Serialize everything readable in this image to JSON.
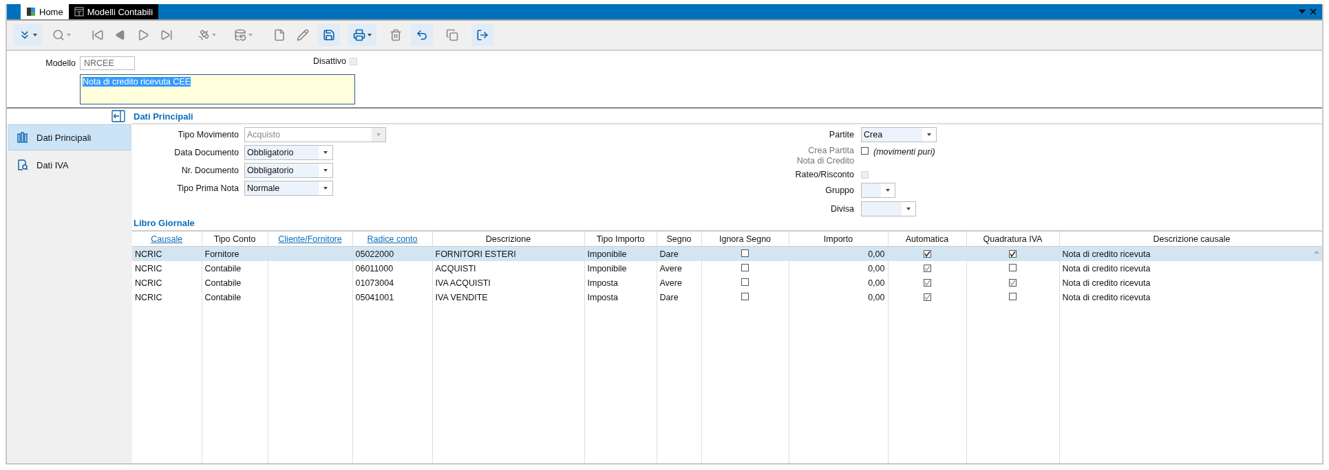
{
  "tabs": [
    {
      "label": "Home",
      "selected": false
    },
    {
      "label": "Modelli Contabili",
      "selected": true
    }
  ],
  "toolbar": [
    {
      "highlighted": true,
      "dropdown": true,
      "disabled": false
    },
    {
      "highlighted": false,
      "dropdown": true,
      "disabled": true
    },
    {
      "highlighted": false,
      "dropdown": false,
      "disabled": true
    },
    {
      "highlighted": false,
      "dropdown": false,
      "disabled": true
    },
    {
      "highlighted": false,
      "dropdown": false,
      "disabled": true
    },
    {
      "highlighted": false,
      "dropdown": false,
      "disabled": true
    },
    {
      "highlighted": false,
      "dropdown": true,
      "disabled": true
    },
    {
      "highlighted": false,
      "dropdown": true,
      "disabled": true
    },
    {
      "highlighted": false,
      "dropdown": false,
      "disabled": true
    },
    {
      "highlighted": false,
      "dropdown": false,
      "disabled": true
    },
    {
      "highlighted": true,
      "dropdown": false,
      "disabled": false
    },
    {
      "highlighted": true,
      "dropdown": true,
      "disabled": false
    },
    {
      "highlighted": false,
      "dropdown": false,
      "disabled": true
    },
    {
      "highlighted": true,
      "dropdown": false,
      "disabled": false
    },
    {
      "highlighted": false,
      "dropdown": false,
      "disabled": true
    },
    {
      "highlighted": true,
      "dropdown": false,
      "disabled": false
    }
  ],
  "header": {
    "model_label": "Modello",
    "model_code": "NRCEE",
    "inactive_label": "Disattivo",
    "inactive_checked": false,
    "description": "Nota di credito ricevuta CEE"
  },
  "sidebar": {
    "items": [
      {
        "label": "Dati Principali",
        "selected": true
      },
      {
        "label": "Dati IVA",
        "selected": false
      }
    ]
  },
  "section_title": "Dati Principali",
  "left_fields": [
    {
      "label": "Tipo Movimento",
      "value": "Acquisto",
      "disabled": true
    },
    {
      "label": "Data Documento",
      "value": "Obbligatorio",
      "disabled": false
    },
    {
      "label": "Nr. Documento",
      "value": "Obbligatorio",
      "disabled": false
    },
    {
      "label": "Tipo Prima Nota",
      "value": "Normale",
      "disabled": false
    }
  ],
  "right_fields": [
    {
      "kind": "select",
      "label": "Partite",
      "value": "Crea"
    },
    {
      "kind": "checkbox",
      "label": "Crea Partita Nota di Credito",
      "checked": false,
      "disabled": false,
      "muted_label": true,
      "hint": "(movimenti puri)"
    },
    {
      "kind": "checkbox",
      "label": "Rateo/Risconto",
      "checked": false,
      "disabled": true,
      "muted_label": false
    },
    {
      "kind": "select",
      "label": "Gruppo"
    },
    {
      "kind": "select",
      "label": "Divisa"
    }
  ],
  "journal": {
    "title": "Libro Giornale",
    "columns": [
      {
        "label": "Causale",
        "link": true,
        "kind": "text"
      },
      {
        "label": "Tipo Conto",
        "link": false,
        "kind": "text"
      },
      {
        "label": "Cliente/Fornitore",
        "link": true,
        "kind": "text"
      },
      {
        "label": "Radice conto",
        "link": true,
        "kind": "text"
      },
      {
        "label": "Descrizione",
        "link": false,
        "kind": "text"
      },
      {
        "label": "Tipo Importo",
        "link": false,
        "kind": "text"
      },
      {
        "label": "Segno",
        "link": false,
        "kind": "text"
      },
      {
        "label": "Ignora Segno",
        "link": false,
        "kind": "check"
      },
      {
        "label": "Importo",
        "link": false,
        "kind": "number"
      },
      {
        "label": "Automatica",
        "link": false,
        "kind": "check"
      },
      {
        "label": "Quadratura IVA",
        "link": false,
        "kind": "check"
      },
      {
        "label": "Descrizione causale",
        "link": false,
        "kind": "text"
      }
    ],
    "rows": [
      {
        "selected": true,
        "cells": [
          "NCRIC",
          "Fornitore",
          null,
          "05022000",
          "FORNITORI ESTERI",
          "Imponibile",
          "Dare",
          false,
          "0,00",
          true,
          true,
          "Nota di credito ricevuta"
        ]
      },
      {
        "selected": false,
        "cells": [
          "NCRIC",
          "Contabile",
          null,
          "06011000",
          "ACQUISTI",
          "Imponibile",
          "Avere",
          false,
          "0,00",
          true,
          false,
          "Nota di credito ricevuta"
        ]
      },
      {
        "selected": false,
        "cells": [
          "NCRIC",
          "Contabile",
          null,
          "01073004",
          "IVA ACQUISTI",
          "Imposta",
          "Avere",
          false,
          "0,00",
          true,
          true,
          "Nota di credito ricevuta"
        ]
      },
      {
        "selected": false,
        "cells": [
          "NCRIC",
          "Contabile",
          null,
          "05041001",
          "IVA VENDITE",
          "Imposta",
          "Dare",
          false,
          "0,00",
          true,
          false,
          "Nota di credito ricevuta"
        ]
      }
    ]
  }
}
